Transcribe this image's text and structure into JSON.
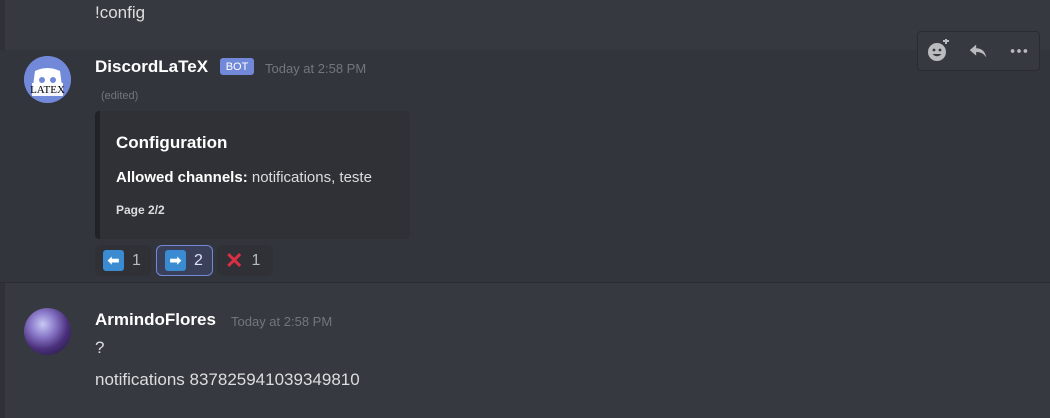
{
  "previous_message": {
    "text": "!config"
  },
  "bot_message": {
    "username": "DiscordLaTeX",
    "badge": "BOT",
    "timestamp": "Today at 2:58 PM",
    "edited": "(edited)",
    "avatar_text": "LATEX",
    "embed": {
      "title": "Configuration",
      "field_label": "Allowed channels:",
      "field_value": "notifications, teste",
      "footer": "Page 2/2"
    },
    "reactions": [
      {
        "emoji": "left-arrow",
        "count": "1",
        "active": false
      },
      {
        "emoji": "right-arrow",
        "count": "2",
        "active": true
      },
      {
        "emoji": "x-mark",
        "count": "1",
        "active": false
      }
    ]
  },
  "user_message": {
    "username": "ArmindoFlores",
    "timestamp": "Today at 2:58 PM",
    "lines": [
      "?",
      "notifications 837825941039349810"
    ]
  },
  "toolbar": {
    "icons": [
      "add-reaction-icon",
      "reply-icon",
      "more-icon"
    ]
  },
  "colors": {
    "background": "#36393f",
    "blurple": "#7289da",
    "embed_bg": "#2f3136"
  }
}
